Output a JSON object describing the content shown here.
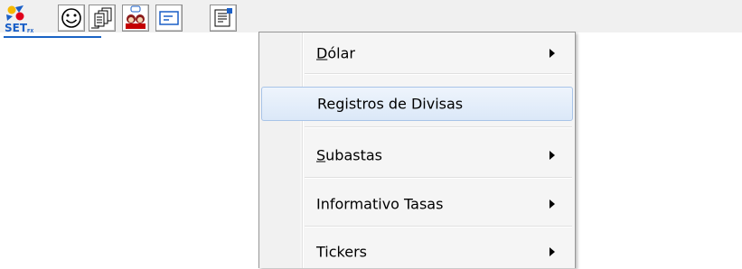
{
  "app": {
    "logo_text": "SET",
    "logo_sub": "FX"
  },
  "toolbar": {
    "buttons": [
      {
        "name": "smiley-icon"
      },
      {
        "name": "stacked-documents-icon"
      },
      {
        "name": "users-chat-icon"
      },
      {
        "name": "message-card-icon"
      },
      {
        "name": "report-menu-icon"
      }
    ]
  },
  "menu": {
    "items": [
      {
        "label": "Dólar",
        "accel": "D",
        "rest": "ólar",
        "submenu": true
      },
      {
        "label": "Registros de Divisas",
        "submenu": false
      },
      {
        "label": "Subastas",
        "accel": "S",
        "rest": "ubastas",
        "submenu": true
      },
      {
        "label": "Informativo Tasas",
        "submenu": true
      },
      {
        "label": "Tickers",
        "submenu": true
      }
    ]
  },
  "colors": {
    "accent": "#1a63c4",
    "highlight_border": "#a8c4e8"
  }
}
